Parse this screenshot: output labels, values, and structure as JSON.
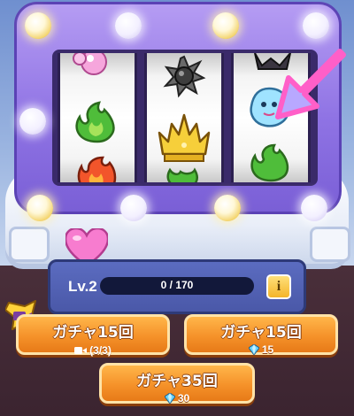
{
  "level": {
    "label": "Lv.2",
    "progress_text": "0 / 170",
    "progress_current": 0,
    "progress_max": 170
  },
  "info_button": {
    "label": "i"
  },
  "buttons": [
    {
      "title": "ガチャ15回",
      "cost_text": "(3/3)",
      "cost_icon": "video-camera-icon"
    },
    {
      "title": "ガチャ15回",
      "cost_text": "15",
      "cost_icon": "gem-icon"
    },
    {
      "title": "ガチャ35回",
      "cost_text": "30",
      "cost_icon": "gem-icon"
    }
  ],
  "reels": [
    {
      "symbols": [
        "pink-bubble-icon",
        "green-flame-icon",
        "red-flame-icon"
      ]
    },
    {
      "symbols": [
        "spiked-mace-icon",
        "golden-crown-icon",
        "green-flame-icon"
      ]
    },
    {
      "symbols": [
        "dark-creature-icon",
        "blue-ghost-icon",
        "green-flame-icon"
      ]
    }
  ],
  "colors": {
    "machine_purple": "#8f73e4",
    "button_orange": "#f5922a",
    "progress_green": "#3bd36a",
    "arrow_pink": "#ff5fc8",
    "panel_blue": "#4a58a8"
  }
}
